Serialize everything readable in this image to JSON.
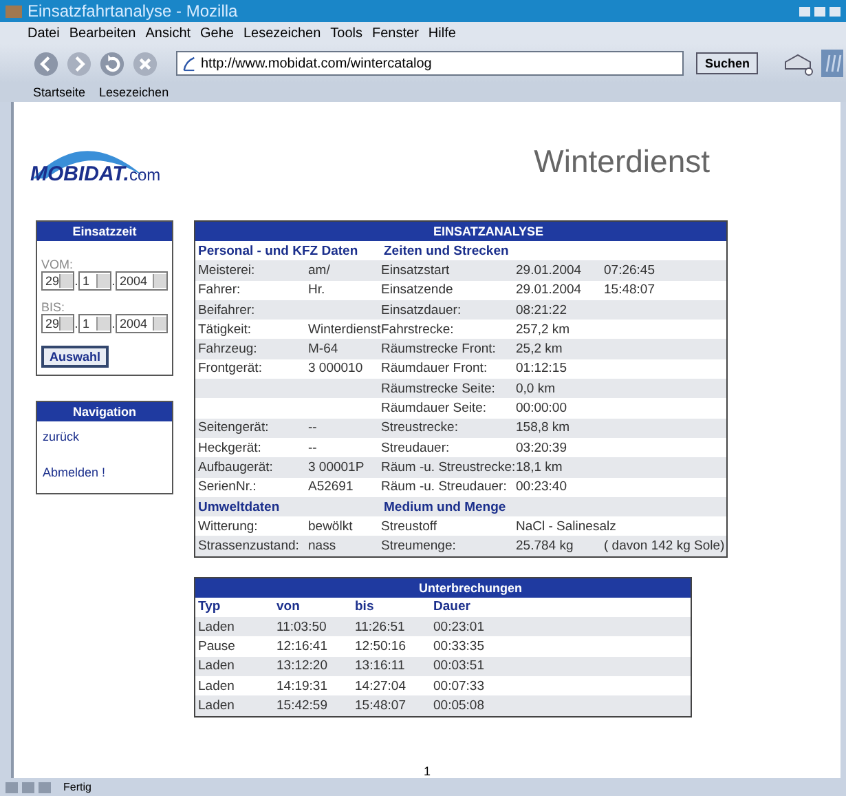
{
  "window": {
    "title": "Einsatzfahrtanalyse - Mozilla"
  },
  "menu": [
    "Datei",
    "Bearbeiten",
    "Ansicht",
    "Gehe",
    "Lesezeichen",
    "Tools",
    "Fenster",
    "Hilfe"
  ],
  "toolbar": {
    "url": "http://www.mobidat.com/wintercatalog",
    "search_button": "Suchen"
  },
  "bookmarks": [
    "Startseite",
    "Lesezeichen"
  ],
  "header": {
    "logo_main": "MOBIDAT.",
    "logo_suffix": "com",
    "title": "Winterdienst"
  },
  "einsatzzeit": {
    "title": "Einsatzzeit",
    "ranges": [
      {
        "label": "VOM:",
        "day": "29",
        "separator_1": ".",
        "month": "1",
        "separator_2": ".",
        "year": "2004"
      },
      {
        "label": "BIS:",
        "day": "29",
        "separator_1": ".",
        "month": "1",
        "separator_2": ".",
        "year": "2004"
      }
    ],
    "button": "Auswahl"
  },
  "navigation": {
    "title": "Navigation",
    "links": [
      "zurück",
      "Abmelden !"
    ]
  },
  "analysis": {
    "title": "EINSATZANALYSE",
    "rows": [
      {
        "kind": "section",
        "left": "Personal - und KFZ Daten",
        "right": "Zeiten und Strecken"
      },
      {
        "kind": "data",
        "label": "Meisterei:",
        "value": "am/",
        "rlabel": "Einsatzstart",
        "rvalue": "29.01.2004",
        "rextra": "07:26:45"
      },
      {
        "kind": "data",
        "label": "Fahrer:",
        "value": "Hr.",
        "rlabel": "Einsatzende",
        "rvalue": "29.01.2004",
        "rextra": "15:48:07"
      },
      {
        "kind": "data",
        "label": "Beifahrer:",
        "value": "",
        "rlabel": "Einsatzdauer:",
        "rvalue": "08:21:22",
        "rextra": ""
      },
      {
        "kind": "data",
        "label": "Tätigkeit:",
        "value": "Winterdienst",
        "rlabel": "Fahrstrecke:",
        "rvalue": "257,2 km",
        "rextra": ""
      },
      {
        "kind": "data",
        "label": "Fahrzeug:",
        "value": "M-64",
        "rlabel": "Räumstrecke Front:",
        "rvalue": "25,2 km",
        "rextra": ""
      },
      {
        "kind": "data",
        "label": "Frontgerät:",
        "value": "3 000010",
        "rlabel": "Räumdauer Front:",
        "rvalue": "01:12:15",
        "rextra": ""
      },
      {
        "kind": "data",
        "label": "",
        "value": "",
        "rlabel": "Räumstrecke Seite:",
        "rvalue": "0,0 km",
        "rextra": ""
      },
      {
        "kind": "data",
        "label": "",
        "value": "",
        "rlabel": "Räumdauer Seite:",
        "rvalue": "00:00:00",
        "rextra": ""
      },
      {
        "kind": "data",
        "label": "Seitengerät:",
        "value": "--",
        "rlabel": "Streustrecke:",
        "rvalue": "158,8 km",
        "rextra": ""
      },
      {
        "kind": "data",
        "label": "Heckgerät:",
        "value": "--",
        "rlabel": "Streudauer:",
        "rvalue": "03:20:39",
        "rextra": ""
      },
      {
        "kind": "data",
        "label": "Aufbaugerät:",
        "value": "3 00001P",
        "rlabel": "Räum -u. Streustrecke:",
        "rvalue": "18,1 km",
        "rextra": ""
      },
      {
        "kind": "data",
        "label": "SerienNr.:",
        "value": "A52691",
        "rlabel": "Räum -u. Streudauer:",
        "rvalue": "00:23:40",
        "rextra": ""
      },
      {
        "kind": "section",
        "left": "Umweltdaten",
        "right": "Medium und Menge"
      },
      {
        "kind": "data",
        "label": "Witterung:",
        "value": "bewölkt",
        "rlabel": "Streustoff",
        "rvalue": "NaCl - Salinesalz",
        "rextra": ""
      },
      {
        "kind": "data",
        "label": "Strassenzustand:",
        "value": "nass",
        "rlabel": "Streumenge:",
        "rvalue": "25.784 kg",
        "rextra": "( davon 142 kg Sole)"
      }
    ]
  },
  "interruptions": {
    "title": "Unterbrechungen",
    "columns": [
      "Typ",
      "von",
      "bis",
      "Dauer"
    ],
    "rows": [
      [
        "Laden",
        "11:03:50",
        "11:26:51",
        "00:23:01"
      ],
      [
        "Pause",
        "12:16:41",
        "12:50:16",
        "00:33:35"
      ],
      [
        "Laden",
        "13:12:20",
        "13:16:11",
        "00:03:51"
      ],
      [
        "Laden",
        "14:19:31",
        "14:27:04",
        "00:07:33"
      ],
      [
        "Laden",
        "15:42:59",
        "15:48:07",
        "00:05:08"
      ]
    ]
  },
  "page_number": "1",
  "status_bar": "Fertig"
}
